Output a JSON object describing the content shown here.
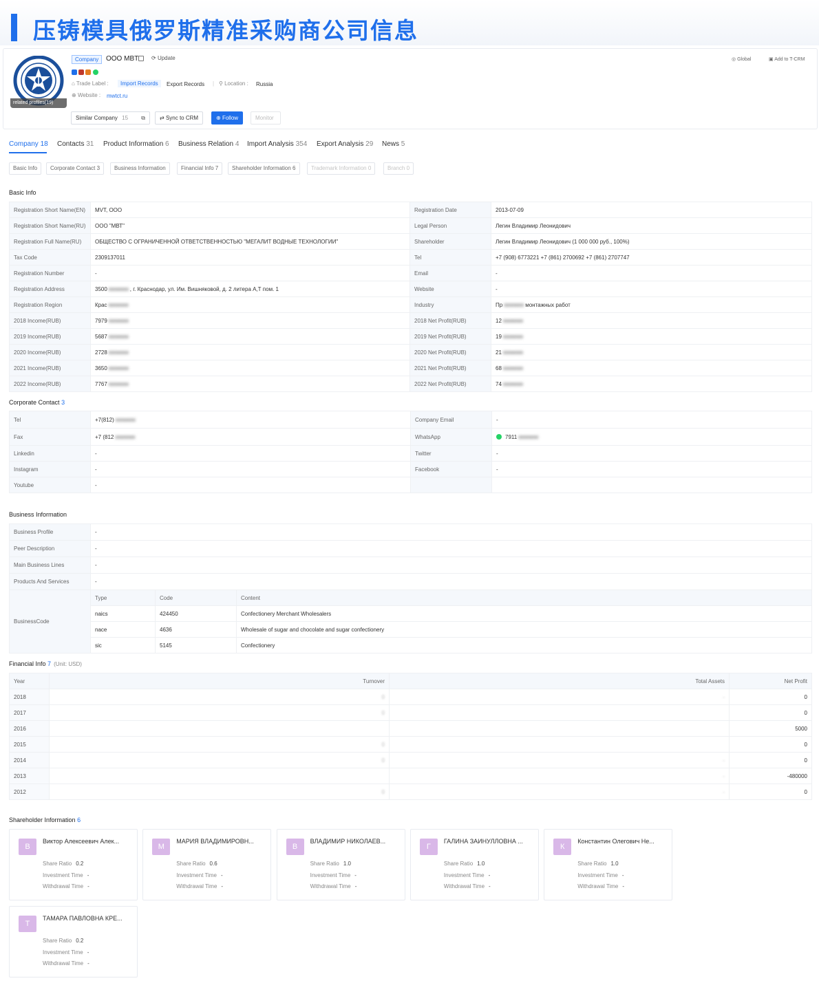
{
  "banner": {
    "title": "压铸模具俄罗斯精准采购商公司信息"
  },
  "header": {
    "company_tag": "Company",
    "company_name": "OOO MBT",
    "update": "Update",
    "trade_label": "Trade Label :",
    "import_records": "Import Records",
    "export_records": "Export Records",
    "location_label": "Location :",
    "location": "Russia",
    "website_label": "Website :",
    "website": "mwtct.ru",
    "logo_caption": "related profiles(19)",
    "global": "Global",
    "add_crm": "Add to T-CRM",
    "similar": "Similar Company",
    "similar_count": "15",
    "sync": "Sync to CRM",
    "follow": "Follow",
    "monitor": "Monitor"
  },
  "tabs": [
    {
      "label": "Company",
      "n": "18"
    },
    {
      "label": "Contacts",
      "n": "31"
    },
    {
      "label": "Product Information",
      "n": "6"
    },
    {
      "label": "Business Relation",
      "n": "4"
    },
    {
      "label": "Import Analysis",
      "n": "354"
    },
    {
      "label": "Export Analysis",
      "n": "29"
    },
    {
      "label": "News",
      "n": "5"
    }
  ],
  "subtabs": [
    "Basic Info",
    "Corporate Contact 3",
    "Business Information",
    "Financial Info 7",
    "Shareholder Information 6",
    "Trademark Information 0",
    "Branch 0"
  ],
  "basic": {
    "title": "Basic Info",
    "rows": [
      [
        "Registration Short Name(EN)",
        "MVT, OOO",
        "Registration Date",
        "2013-07-09"
      ],
      [
        "Registration Short Name(RU)",
        "ООО \"МВТ\"",
        "Legal Person",
        "Легин Владимир Леонидович"
      ],
      [
        "Registration Full Name(RU)",
        "ОБЩЕСТВО С ОГРАНИЧЕННОЙ ОТВЕТСТВЕННОСТЬЮ \"МЕГАЛИТ ВОДНЫЕ ТЕХНОЛОГИИ\"",
        "Shareholder",
        "Легин Владимир Леонидович (1 000 000 руб., 100%)"
      ],
      [
        "Tax Code",
        "2309137011",
        "Tel",
        "+7 (908) 6773221 +7 (861) 2700692 +7 (861) 2707747"
      ],
      [
        "Registration Number",
        "-",
        "Email",
        "-"
      ],
      [
        "Registration Address",
        "3500",
        "Website",
        "-"
      ],
      [
        "Registration Region",
        "Крас",
        "Industry",
        "Пр"
      ],
      [
        "2018 Income(RUB)",
        "7979",
        "2018 Net Profit(RUB)",
        "12"
      ],
      [
        "2019 Income(RUB)",
        "5687",
        "2019 Net Profit(RUB)",
        "19"
      ],
      [
        "2020 Income(RUB)",
        "2728",
        "2020 Net Profit(RUB)",
        "21"
      ],
      [
        "2021 Income(RUB)",
        "3650",
        "2021 Net Profit(RUB)",
        "68"
      ],
      [
        "2022 Income(RUB)",
        "7767",
        "2022 Net Profit(RUB)",
        "74"
      ]
    ],
    "addr_tail": ", г. Краснодар, ул. Им. Вишняковой, д. 2 литера А,Т пом. 1",
    "industry_tail": "монтажных работ"
  },
  "contact": {
    "title": "Corporate Contact",
    "count": "3",
    "rows": [
      [
        "Tel",
        "+7(812)",
        "Company Email",
        "-"
      ],
      [
        "Fax",
        "+7 (812",
        "WhatsApp",
        "7911"
      ],
      [
        "Linkedin",
        "-",
        "Twitter",
        "-"
      ],
      [
        "Instagram",
        "-",
        "Facebook",
        "-"
      ],
      [
        "Youtube",
        "-",
        "",
        ""
      ]
    ]
  },
  "business": {
    "title": "Business Information",
    "rows": [
      [
        "Business Profile",
        "-"
      ],
      [
        "Peer Description",
        "-"
      ],
      [
        "Main Business Lines",
        "-"
      ],
      [
        "Products And Services",
        "-"
      ]
    ],
    "code_label": "BusinessCode",
    "code_headers": [
      "Type",
      "Code",
      "Content"
    ],
    "codes": [
      [
        "naics",
        "424450",
        "Confectionery Merchant Wholesalers"
      ],
      [
        "nace",
        "4636",
        "Wholesale of sugar and chocolate and sugar confectionery"
      ],
      [
        "sic",
        "5145",
        "Confectionery"
      ]
    ]
  },
  "financial": {
    "title": "Financial Info",
    "count": "7",
    "unit": "(Unit: USD)",
    "headers": [
      "Year",
      "Turnover",
      "Total Assets",
      "Net Profit"
    ],
    "rows": [
      [
        "2018",
        "0",
        "-",
        "0"
      ],
      [
        "2017",
        "0",
        "",
        "0"
      ],
      [
        "2016",
        "",
        "",
        "5000"
      ],
      [
        "2015",
        "0",
        "",
        "0"
      ],
      [
        "2014",
        "0",
        "-",
        "0"
      ],
      [
        "2013",
        "",
        "-",
        "-480000"
      ],
      [
        "2012",
        "0",
        "-",
        "0"
      ]
    ]
  },
  "shareholders": {
    "title": "Shareholder Information",
    "count": "6",
    "labels": {
      "ratio": "Share Ratio",
      "invest": "Investment Time",
      "withdraw": "Withdrawal Time"
    },
    "items": [
      {
        "initial": "В",
        "name": "Виктор Алексеевич Алек...",
        "ratio": "0.2",
        "invest": "-",
        "withdraw": "-"
      },
      {
        "initial": "М",
        "name": "МАРИЯ ВЛАДИМИРОВН...",
        "ratio": "0.6",
        "invest": "-",
        "withdraw": "-"
      },
      {
        "initial": "В",
        "name": "ВЛАДИМИР НИКОЛАЕВ...",
        "ratio": "1.0",
        "invest": "-",
        "withdraw": "-"
      },
      {
        "initial": "Г",
        "name": "ГАЛИНА ЗАИНУЛЛОВНА ...",
        "ratio": "1.0",
        "invest": "-",
        "withdraw": "-"
      },
      {
        "initial": "К",
        "name": "Константин Олегович Не...",
        "ratio": "1.0",
        "invest": "-",
        "withdraw": "-"
      },
      {
        "initial": "Т",
        "name": "ТАМАРА ПАВЛОВНА КРЕ...",
        "ratio": "0.2",
        "invest": "-",
        "withdraw": "-"
      }
    ]
  }
}
